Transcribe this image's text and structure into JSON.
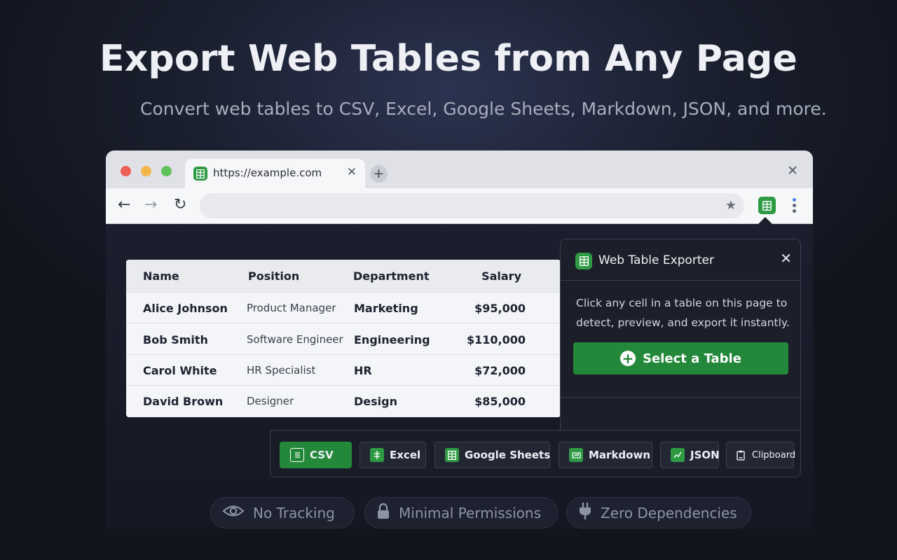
{
  "hero": {
    "title": "Export Web Tables from Any Page",
    "subtitle": "Convert web tables to CSV, Excel, Google Sheets, Markdown, JSON, and more."
  },
  "browser": {
    "tab_title": "https://example.com",
    "tab_close": "✕",
    "new_tab": "+",
    "window_close": "✕",
    "nav_back": "←",
    "nav_forward": "→",
    "nav_reload": "↻",
    "bookmark": "★"
  },
  "table": {
    "headers": [
      "Name",
      "Position",
      "Department",
      "Salary"
    ],
    "rows": [
      [
        "Alice Johnson",
        "Product Manager",
        "Marketing",
        "$95,000"
      ],
      [
        "Bob Smith",
        "Software Engineer",
        "Engineering",
        "$110,000"
      ],
      [
        "Carol White",
        "HR Specialist",
        "HR",
        "$72,000"
      ],
      [
        "David Brown",
        "Designer",
        "Design",
        "$85,000"
      ]
    ]
  },
  "popup": {
    "title": "Web Table Exporter",
    "close": "✕",
    "description": "Click any cell in a table on this page to detect, preview, and export it instantly.",
    "select_button": "Select a Table",
    "plus": "+"
  },
  "formats": [
    {
      "label": "CSV",
      "icon": "document-icon"
    },
    {
      "label": "Excel",
      "icon": "excel-icon"
    },
    {
      "label": "Google Sheets",
      "icon": "sheets-icon"
    },
    {
      "label": "Markdown",
      "icon": "markdown-icon"
    },
    {
      "label": "JSON",
      "icon": "json-icon"
    },
    {
      "label": "Clipboard",
      "icon": "clipboard-icon"
    }
  ],
  "features": [
    {
      "label": "No Tracking",
      "icon": "eye-icon"
    },
    {
      "label": "Minimal Permissions",
      "icon": "lock-icon"
    },
    {
      "label": "Zero Dependencies",
      "icon": "plug-icon"
    }
  ],
  "colors": {
    "accent_green": "#23883a",
    "traffic_red": "#ee5f57",
    "traffic_yellow": "#f2b64a",
    "traffic_green": "#5fc25a",
    "kebab_top": "#4a82f0",
    "kebab_rest": "#5f6470"
  }
}
